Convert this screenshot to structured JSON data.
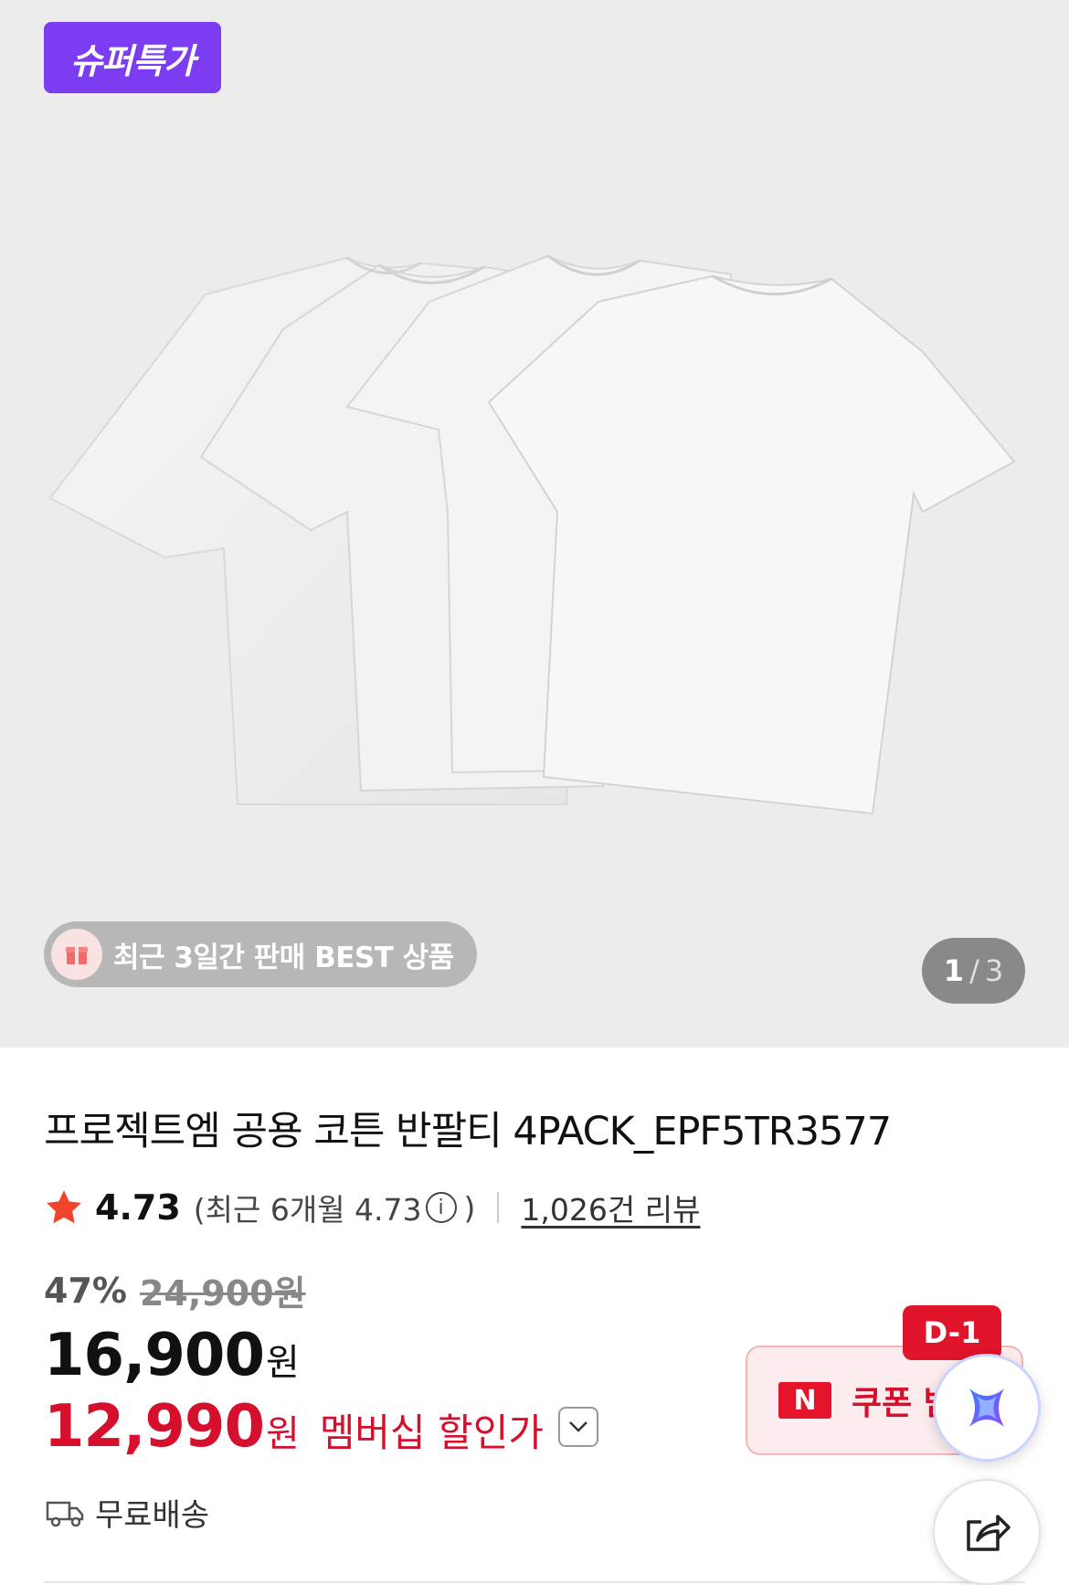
{
  "gallery": {
    "badge_label": "슈퍼특가",
    "best_label": "최근 3일간 판매 BEST 상품",
    "counter_current": "1",
    "counter_separator": "/",
    "counter_total": "3"
  },
  "product": {
    "title": "프로젝트엠 공용 코튼 반팔티 4PACK_EPF5TR3577",
    "rating": "4.73",
    "rating_recent_prefix": "(최근 6개월 4.73",
    "rating_recent_suffix": ")",
    "review_link": "1,026건 리뷰",
    "discount_rate": "47%",
    "original_price": "24,900원",
    "price": "16,900",
    "price_unit": "원",
    "member_price": "12,990",
    "member_price_unit": "원",
    "member_label": "멤버십 할인가",
    "shipping": "무료배송"
  },
  "coupon": {
    "logo_letter": "N",
    "label": "쿠폰 받",
    "dday": "D-1"
  },
  "icons": {
    "star": "star-icon",
    "info": "info-icon",
    "truck": "truck-icon",
    "chevron": "chevron-down-icon",
    "share": "share-icon",
    "ai": "ai-assistant-icon",
    "gift": "gift-icon"
  },
  "colors": {
    "badge": "#7b3cf2",
    "accent_red": "#d60f2c",
    "star": "#f0442c",
    "hero_bg": "#ececec"
  }
}
